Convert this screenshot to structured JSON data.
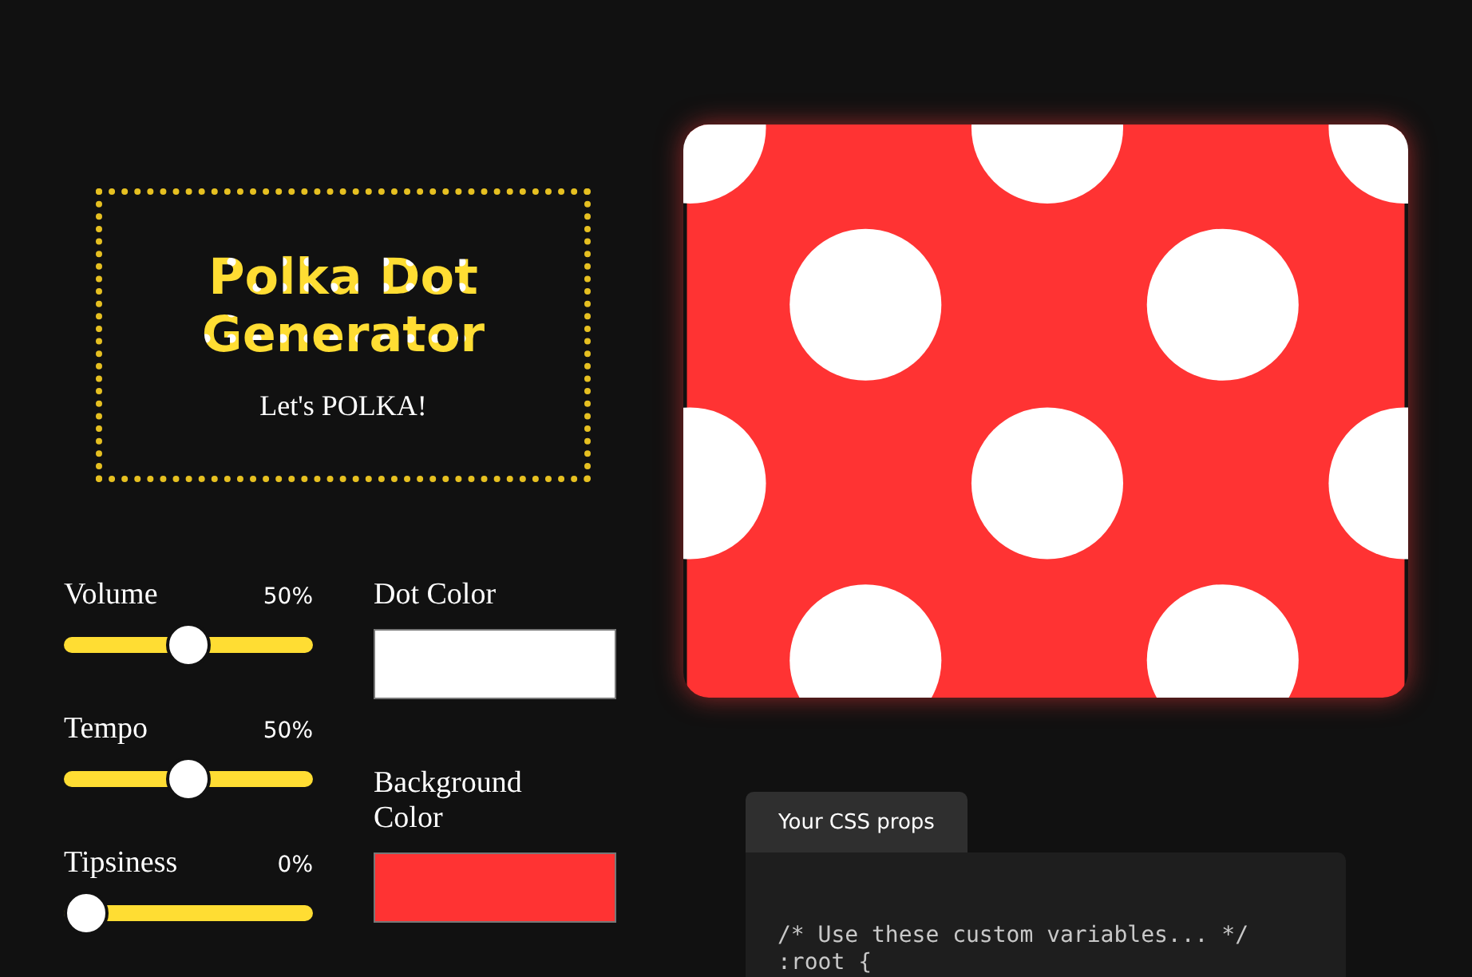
{
  "title": {
    "heading": "Polka Dot Generator",
    "tagline": "Let's POLKA!"
  },
  "sliders": [
    {
      "label": "Volume",
      "reading": "50%",
      "level": 0.5
    },
    {
      "label": "Tempo",
      "reading": "50%",
      "level": 0.5
    },
    {
      "label": "Tipsiness",
      "reading": "0%",
      "level": 0
    }
  ],
  "colors": [
    {
      "label": "Dot Color",
      "color": "#ffffff"
    },
    {
      "label": "Background Color",
      "color": "#ff3333"
    }
  ],
  "code_panel": {
    "tab": "Your CSS props",
    "lines": [
      "/* Use these custom variables... */",
      ":root {"
    ]
  }
}
